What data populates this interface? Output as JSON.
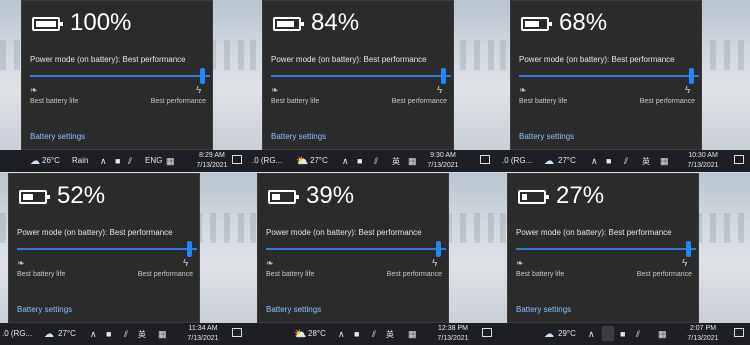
{
  "flyouts": [
    {
      "percent": "100%",
      "mode": "Power mode (on battery): Best performance",
      "left_label": "Best battery life",
      "right_label": "Best performance",
      "link": "Battery settings",
      "charge": 1.0,
      "taskbar": {
        "prefix": "",
        "temp": "26°C",
        "weather": "Rain",
        "lang": "ENG",
        "time": "8:29 AM",
        "date": "7/13/2021"
      }
    },
    {
      "percent": "84%",
      "mode": "Power mode (on battery): Best performance",
      "left_label": "Best battery life",
      "right_label": "Best performance",
      "link": "Battery settings",
      "charge": 0.84,
      "taskbar": {
        "prefix": ".0 (RG...",
        "temp": "27°C",
        "weather": "",
        "lang": "英",
        "time": "9:30 AM",
        "date": "7/13/2021"
      }
    },
    {
      "percent": "68%",
      "mode": "Power mode (on battery): Best performance",
      "left_label": "Best battery life",
      "right_label": "Best performance",
      "link": "Battery settings",
      "charge": 0.68,
      "taskbar": {
        "prefix": ".0 (RG...",
        "temp": "27°C",
        "weather": "",
        "lang": "英",
        "time": "10:30 AM",
        "date": "7/13/2021"
      }
    },
    {
      "percent": "52%",
      "mode": "Power mode (on battery): Best performance",
      "left_label": "Best battery life",
      "right_label": "Best performance",
      "link": "Battery settings",
      "charge": 0.52,
      "taskbar": {
        "prefix": ".0 (RG...",
        "temp": "27°C",
        "weather": "",
        "lang": "英",
        "time": "11:34 AM",
        "date": "7/13/2021"
      }
    },
    {
      "percent": "39%",
      "mode": "Power mode (on battery): Best performance",
      "left_label": "Best battery life",
      "right_label": "Best performance",
      "link": "Battery settings",
      "charge": 0.39,
      "taskbar": {
        "prefix": "",
        "temp": "28°C",
        "weather": "",
        "lang": "英",
        "time": "12:38 PM",
        "date": "7/13/2021"
      }
    },
    {
      "percent": "27%",
      "mode": "Power mode (on battery): Best performance",
      "left_label": "Best battery life",
      "right_label": "Best performance",
      "link": "Battery settings",
      "charge": 0.27,
      "taskbar": {
        "prefix": "",
        "temp": "29°C",
        "weather": "",
        "lang": "英",
        "time": "2:07 PM",
        "date": "7/13/2021"
      }
    }
  ],
  "icons": {
    "weather": "cloud-rain-icon",
    "sun": "partly-sunny-icon",
    "chevron": "chevron-up-icon",
    "network": "wifi-icon",
    "volume": "speaker-icon",
    "ime": "ime-grid-icon",
    "notification": "action-center-icon",
    "leaf": "leaf-icon",
    "bolt": "bolt-icon",
    "battery": "battery-icon"
  },
  "colors": {
    "flyout_bg": "#2b2b2b",
    "accent": "#1f86ff",
    "link": "#8fc1ff",
    "taskbar": "#1d1f24"
  }
}
